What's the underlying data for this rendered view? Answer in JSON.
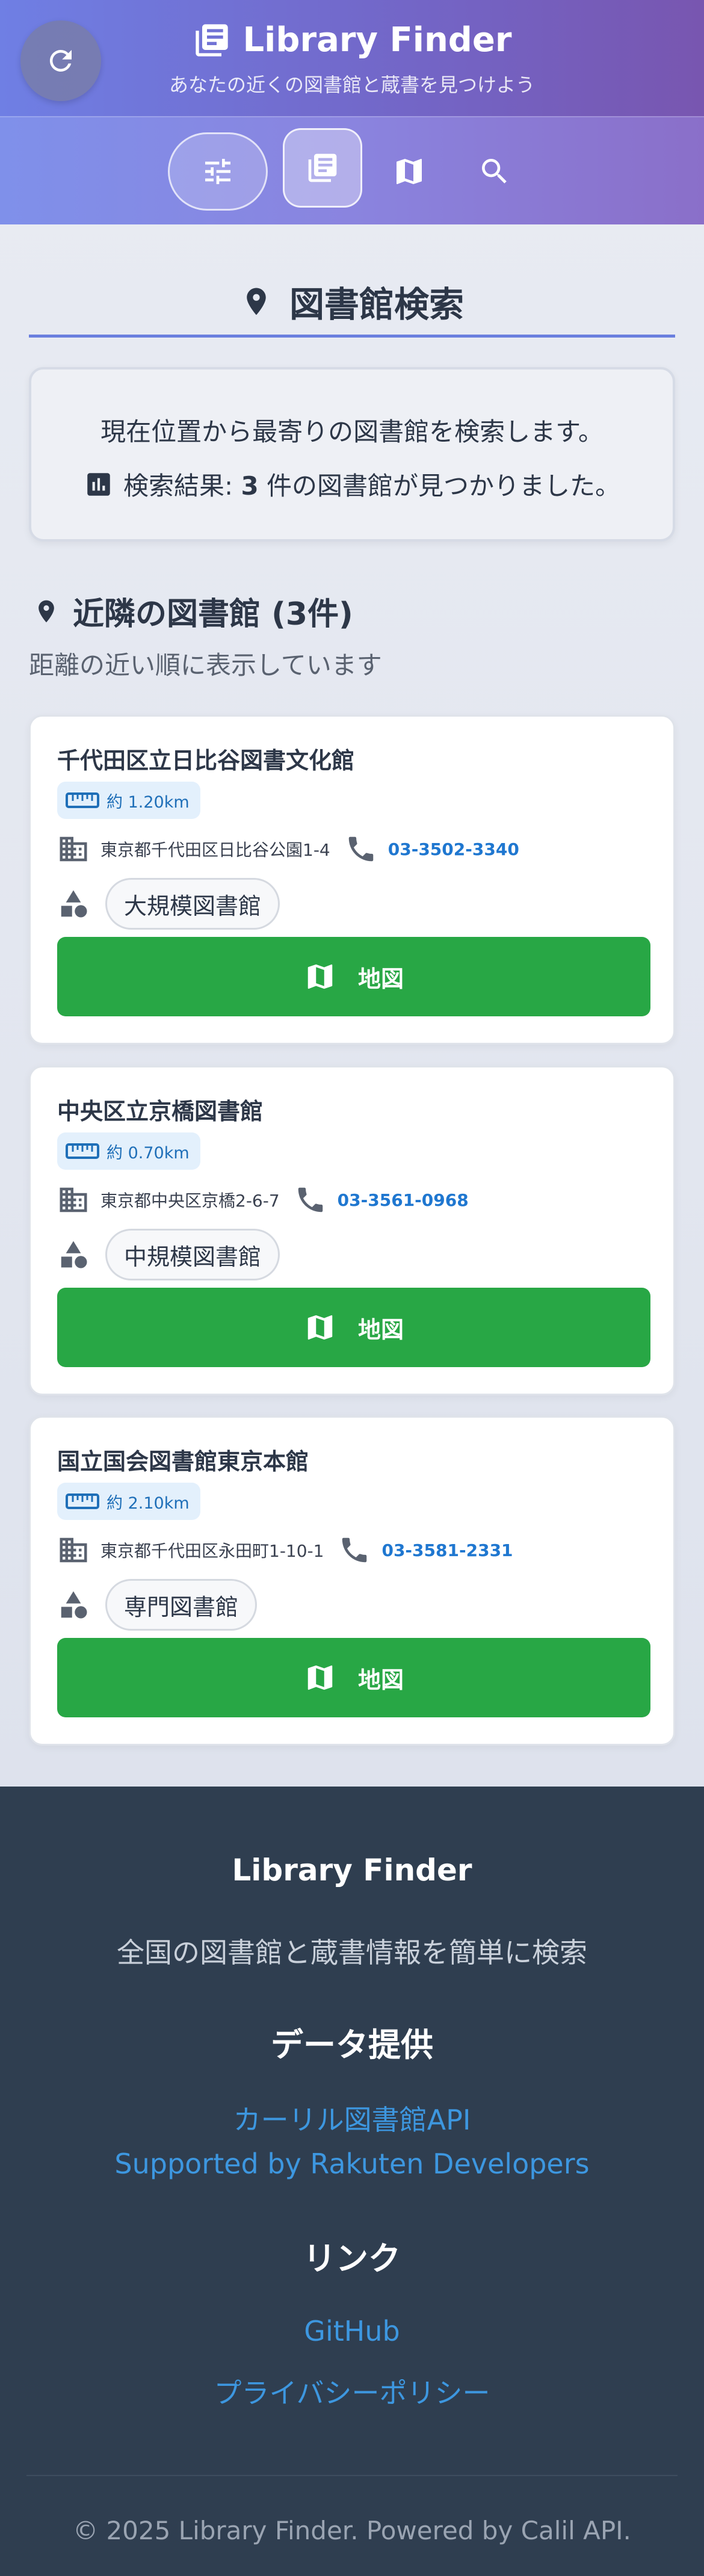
{
  "header": {
    "title": "Library Finder",
    "tagline": "あなたの近くの図書館と蔵書を見つけよう"
  },
  "section": {
    "title": "図書館検索"
  },
  "info": {
    "message": "現在位置から最寄りの図書館を検索します。",
    "result_prefix": "検索結果: ",
    "result_count": "3",
    "result_suffix": " 件の図書館が見つかりました。"
  },
  "nearby": {
    "title": "近隣の図書館 (3件)",
    "subtitle": "距離の近い順に表示しています"
  },
  "libraries": [
    {
      "name": "千代田区立日比谷図書文化館",
      "distance": "約 1.20km",
      "address": "東京都千代田区日比谷公園1-4",
      "phone": "03-3502-3340",
      "type": "大規模図書館",
      "map_label": "地図"
    },
    {
      "name": "中央区立京橋図書館",
      "distance": "約 0.70km",
      "address": "東京都中央区京橋2-6-7",
      "phone": "03-3561-0968",
      "type": "中規模図書館",
      "map_label": "地図"
    },
    {
      "name": "国立国会図書館東京本館",
      "distance": "約 2.10km",
      "address": "東京都千代田区永田町1-10-1",
      "phone": "03-3581-2331",
      "type": "専門図書館",
      "map_label": "地図"
    }
  ],
  "footer": {
    "brand": "Library Finder",
    "description": "全国の図書館と蔵書情報を簡単に検索",
    "data_heading": "データ提供",
    "calil_link": "カーリル図書館API",
    "rakuten_link": "Supported by Rakuten Developers",
    "links_heading": "リンク",
    "github_link": "GitHub",
    "privacy_link": "プライバシーポリシー",
    "copyright": "© 2025 Library Finder. Powered by Calil API."
  },
  "icons": {
    "refresh": "refresh-icon",
    "brand": "book-stack-icon",
    "filter": "sliders-icon",
    "list": "book-list-icon",
    "map": "map-icon",
    "search": "search-icon",
    "pin": "location-pin-icon",
    "chart": "bar-chart-icon",
    "ruler": "ruler-icon",
    "building": "building-icon",
    "phone": "phone-icon",
    "shapes": "category-shapes-icon"
  },
  "colors": {
    "accent": "#6a7fde",
    "map_button": "#28a745",
    "link": "#1f77d0",
    "footer_bg": "#2f3e50"
  }
}
